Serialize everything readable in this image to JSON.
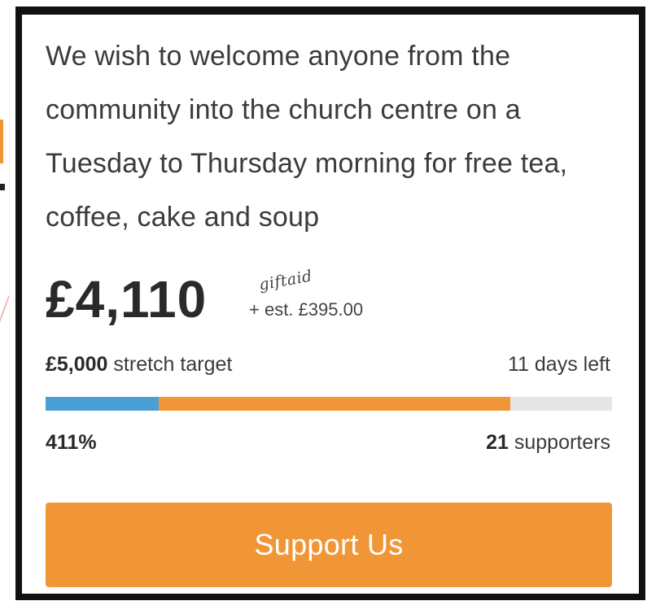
{
  "project": {
    "description": "We wish to welcome anyone from the community into the church centre on a Tuesday to Thursday morning for free tea, coffee, cake and soup",
    "amount_raised": "£4,110",
    "giftaid_logo": "giftaid",
    "giftaid_estimate": "+ est. £395.00",
    "stretch_target_value": "£5,000",
    "stretch_target_label": "stretch target",
    "days_left": "11 days left",
    "percent_funded": "411%",
    "supporters_count": "21",
    "supporters_label": "supporters",
    "support_button_label": "Support Us"
  },
  "progress": {
    "giftaid_fraction": 0.2,
    "raised_fraction": 0.82
  },
  "colors": {
    "accent": "#f19637",
    "giftaid_bar": "#4aa0d4",
    "track": "#e6e6e6",
    "text": "#3b3b3b",
    "border": "#111111"
  }
}
